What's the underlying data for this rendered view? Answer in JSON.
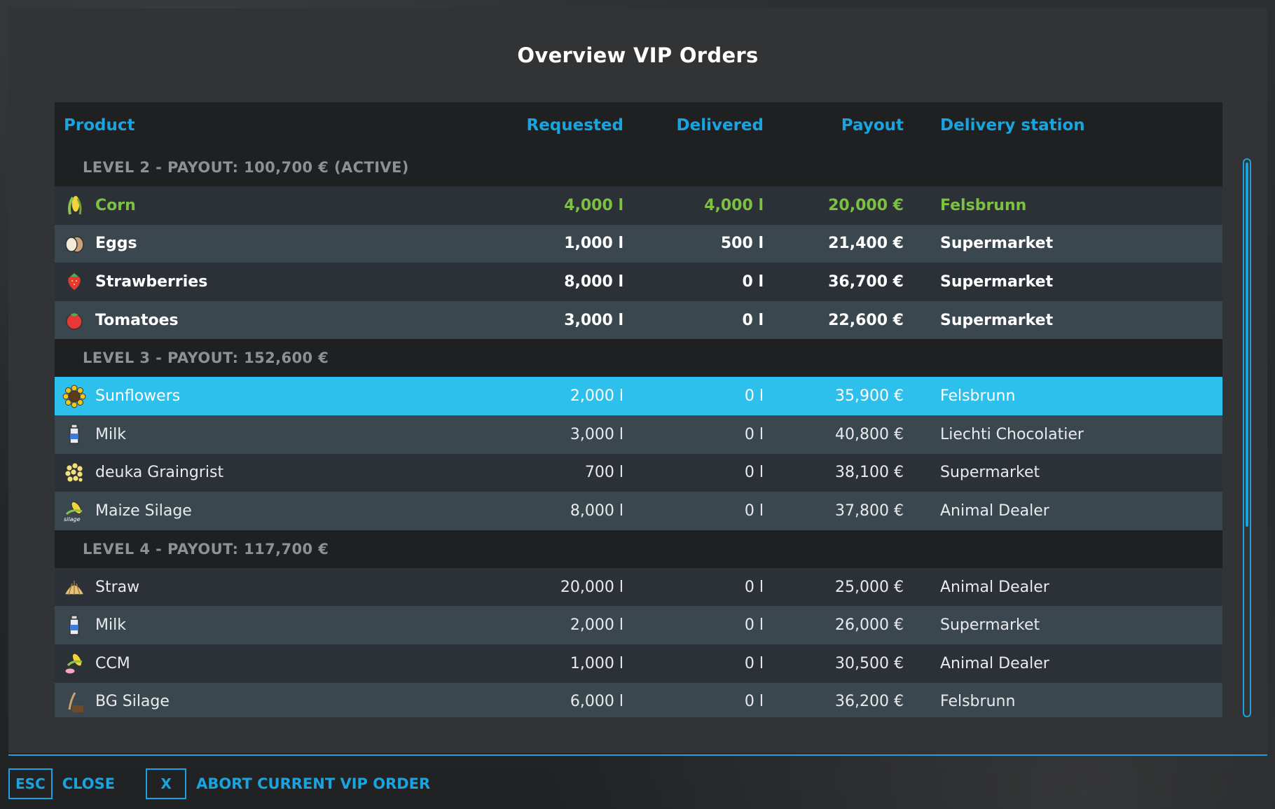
{
  "dialog": {
    "title": "Overview VIP Orders"
  },
  "table": {
    "headers": {
      "product": "Product",
      "requested": "Requested",
      "delivered": "Delivered",
      "payout": "Payout",
      "station": "Delivery station"
    },
    "levels": [
      {
        "label": "LEVEL 2 - PAYOUT: 100,700 € (ACTIVE)",
        "rows": [
          {
            "icon": "corn-icon",
            "product": "Corn",
            "requested": "4,000 l",
            "delivered": "4,000 l",
            "payout": "20,000 €",
            "station": "Felsbrunn"
          },
          {
            "icon": "eggs-icon",
            "product": "Eggs",
            "requested": "1,000 l",
            "delivered": "500 l",
            "payout": "21,400 €",
            "station": "Supermarket"
          },
          {
            "icon": "strawberry-icon",
            "product": "Strawberries",
            "requested": "8,000 l",
            "delivered": "0 l",
            "payout": "36,700 €",
            "station": "Supermarket"
          },
          {
            "icon": "tomato-icon",
            "product": "Tomatoes",
            "requested": "3,000 l",
            "delivered": "0 l",
            "payout": "22,600 €",
            "station": "Supermarket"
          }
        ]
      },
      {
        "label": "LEVEL 3 - PAYOUT: 152,600 €",
        "rows": [
          {
            "icon": "sunflower-icon",
            "product": "Sunflowers",
            "requested": "2,000 l",
            "delivered": "0 l",
            "payout": "35,900 €",
            "station": "Felsbrunn"
          },
          {
            "icon": "milk-icon",
            "product": "Milk",
            "requested": "3,000 l",
            "delivered": "0 l",
            "payout": "40,800 €",
            "station": "Liechti Chocolatier"
          },
          {
            "icon": "graingrist-icon",
            "product": "deuka Graingrist",
            "requested": "700 l",
            "delivered": "0 l",
            "payout": "38,100 €",
            "station": "Supermarket"
          },
          {
            "icon": "maize-silage-icon",
            "product": "Maize Silage",
            "requested": "8,000 l",
            "delivered": "0 l",
            "payout": "37,800 €",
            "station": "Animal Dealer"
          }
        ]
      },
      {
        "label": "LEVEL 4 - PAYOUT: 117,700 €",
        "rows": [
          {
            "icon": "straw-icon",
            "product": "Straw",
            "requested": "20,000 l",
            "delivered": "0 l",
            "payout": "25,000 €",
            "station": "Animal Dealer"
          },
          {
            "icon": "milk-icon",
            "product": "Milk",
            "requested": "2,000 l",
            "delivered": "0 l",
            "payout": "26,000 €",
            "station": "Supermarket"
          },
          {
            "icon": "ccm-icon",
            "product": "CCM",
            "requested": "1,000 l",
            "delivered": "0 l",
            "payout": "30,500 €",
            "station": "Animal Dealer"
          },
          {
            "icon": "bg-silage-icon",
            "product": "BG Silage",
            "requested": "6,000 l",
            "delivered": "0 l",
            "payout": "36,200 €",
            "station": "Felsbrunn"
          }
        ]
      }
    ]
  },
  "icon_text": {
    "silage_tag": "silage"
  },
  "footer": {
    "close_key": "ESC",
    "close_label": "CLOSE",
    "abort_key": "X",
    "abort_label": "ABORT CURRENT VIP ORDER"
  },
  "colors": {
    "accent": "#1aa4df",
    "active": "#7cc142",
    "selected": "#2ec0ec"
  }
}
